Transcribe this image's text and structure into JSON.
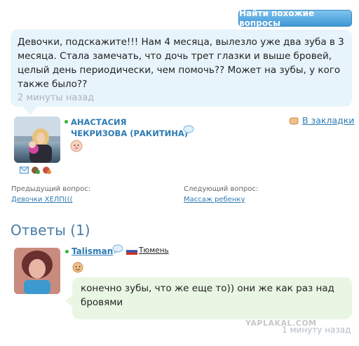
{
  "toolbar": {
    "find_similar_label": "Найти похожие вопросы"
  },
  "question": {
    "text": "Девочки, подскажите!!! Нам 4 месяца, вылезло уже два зуба в 3 месяца. Стала замечать, что дочь трет глазки и выше бровей, целый день периодически, чем помочь?? Может на зубы, у кого также было??",
    "time": "2 минуты назад"
  },
  "author": {
    "name_line1": "АНАСТАСИЯ",
    "name_line2": "ЧЕКРИЗОВА (РАКИТИНА)"
  },
  "bookmark": {
    "label": "В закладки"
  },
  "navigation": {
    "prev_label": "Предыдущий вопрос:",
    "prev_link": "Девочки ХЕЛП(((",
    "next_label": "Следующий вопрос:",
    "next_link": "Массаж ребенку"
  },
  "answers": {
    "heading": "Ответы (1)",
    "items": [
      {
        "user": "Talisman",
        "city": "Тюмень",
        "text": "конечно зубы, что же еще то)) они же как раз над бровями",
        "time": "1 минуту назад"
      }
    ]
  },
  "watermark": "YAPLAKAL.COM",
  "colors": {
    "accent_blue": "#2e7bb3",
    "question_bg": "#e8f4fc",
    "answer_bg": "#eaf6e4",
    "online_dot": "#35b435"
  }
}
